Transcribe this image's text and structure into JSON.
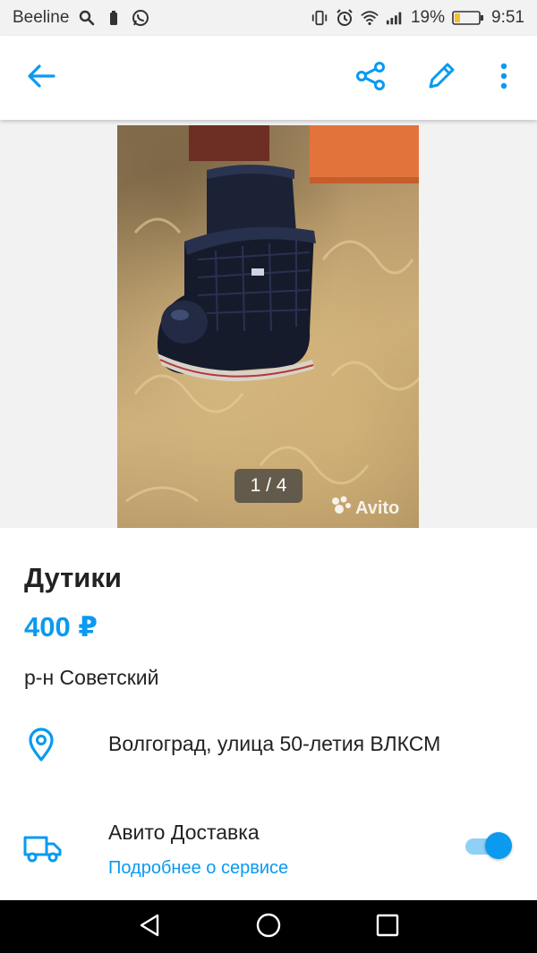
{
  "status_bar": {
    "carrier": "Beeline",
    "battery_percent": "19%",
    "time": "9:51",
    "icons_left": [
      "search-icon",
      "battery-saver-icon",
      "whatsapp-icon"
    ],
    "icons_right": [
      "vibrate-icon",
      "alarm-icon",
      "wifi-icon",
      "signal-icon",
      "battery-icon"
    ]
  },
  "app_bar": {
    "icons": [
      "back-arrow-icon",
      "share-icon",
      "edit-icon",
      "more-vert-icon"
    ]
  },
  "gallery": {
    "counter": "1 / 4",
    "watermark": "Avito"
  },
  "listing": {
    "title": "Дутики",
    "price": "400 ₽",
    "district": "р-н Советский",
    "address": "Волгоград, улица 50-летия ВЛКСМ"
  },
  "delivery": {
    "title": "Авито Доставка",
    "link": "Подробнее о сервисе",
    "enabled": true
  },
  "colors": {
    "accent": "#0a9af0",
    "text": "#222222",
    "status_bar_bg": "#f2f2f2",
    "nav_bar_bg": "#000000"
  }
}
